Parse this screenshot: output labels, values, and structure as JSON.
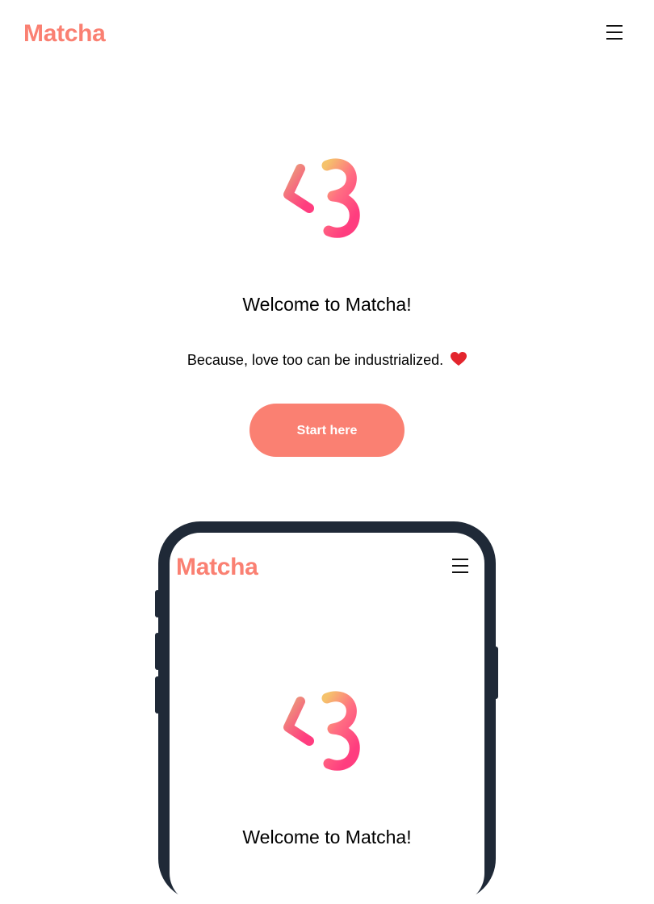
{
  "header": {
    "brand": "Matcha",
    "menu_icon": "hamburger-menu-icon"
  },
  "hero": {
    "logo_icon": "heart-less-than-three-logo-icon",
    "title": "Welcome to Matcha!",
    "tagline": "Because, love too can be industrialized.",
    "tagline_emoji_icon": "red-heart-icon",
    "cta_label": "Start here"
  },
  "phone_preview": {
    "brand": "Matcha",
    "menu_icon": "hamburger-menu-icon",
    "logo_icon": "heart-less-than-three-logo-icon",
    "title": "Welcome to Matcha!"
  },
  "colors": {
    "brand": "#fa8072",
    "cta_bg": "#fa8072",
    "phone_frame": "#1f2937",
    "logo_gradient_start": "#f5c26b",
    "logo_gradient_end": "#ff3d7f"
  }
}
